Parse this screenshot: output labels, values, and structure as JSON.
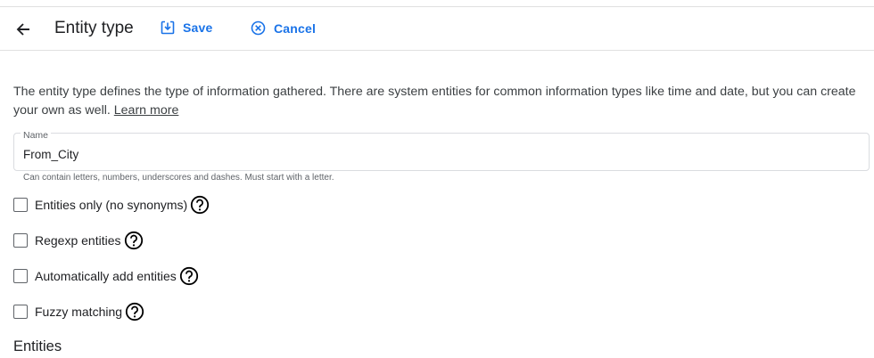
{
  "toolbar": {
    "back_icon": "arrow-left-icon",
    "title": "Entity type",
    "save_label": "Save",
    "save_icon": "save-download-icon",
    "cancel_label": "Cancel",
    "cancel_icon": "cancel-circle-icon",
    "accent_color": "#1a73e8"
  },
  "intro": {
    "text": "The entity type defines the type of information gathered. There are system entities for common information types like time and date, but you can create your own as well.",
    "link_label": "Learn more"
  },
  "name_field": {
    "label": "Name",
    "value": "From_City",
    "hint": "Can contain letters, numbers, underscores and dashes. Must start with a letter."
  },
  "options": [
    {
      "label": "Entities only (no synonyms)",
      "checked": false,
      "help_icon": "help-circle-icon"
    },
    {
      "label": "Regexp entities",
      "checked": false,
      "help_icon": "help-circle-icon"
    },
    {
      "label": "Automatically add entities",
      "checked": false,
      "help_icon": "help-circle-icon"
    },
    {
      "label": "Fuzzy matching",
      "checked": false,
      "help_icon": "help-circle-icon"
    }
  ],
  "entities_section": {
    "title": "Entities"
  }
}
